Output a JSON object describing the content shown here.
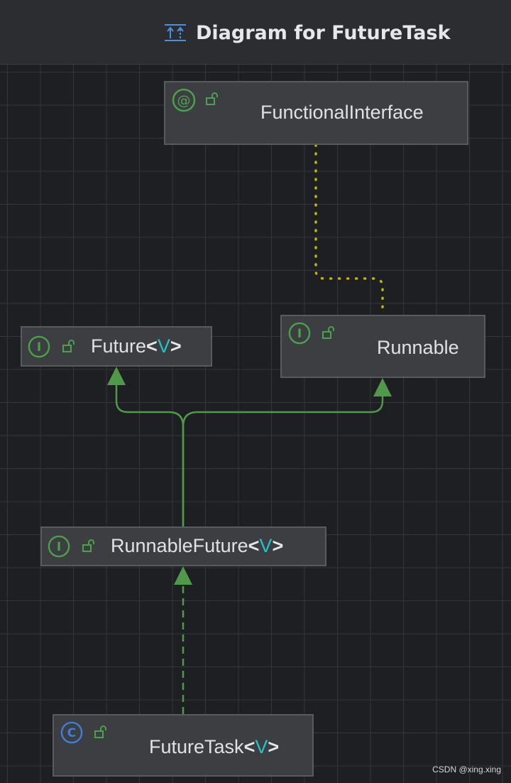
{
  "header": {
    "title": "Diagram for FutureTask",
    "icon": "hierarchy-arrows-icon"
  },
  "nodes": {
    "functional_interface": {
      "badge": "@",
      "kind": "annotation",
      "name": "FunctionalInterface"
    },
    "future": {
      "badge": "I",
      "kind": "interface",
      "name": "Future",
      "type_param": "V"
    },
    "runnable": {
      "badge": "I",
      "kind": "interface",
      "name": "Runnable"
    },
    "runnable_future": {
      "badge": "I",
      "kind": "interface",
      "name": "RunnableFuture",
      "type_param": "V"
    },
    "future_task": {
      "badge": "C",
      "kind": "class",
      "name": "FutureTask",
      "type_param": "V"
    }
  },
  "bracket_open": "<",
  "bracket_close": ">",
  "colors": {
    "background": "#1e1f22",
    "node_fill": "#3c3e42",
    "edge_green": "#4f9a48",
    "annotation_edge": "#c6b400",
    "interface_badge": "#4aa24a",
    "class_badge": "#3f7fd9",
    "type_param": "#22c3c9"
  },
  "watermark": "CSDN @xing.xing"
}
